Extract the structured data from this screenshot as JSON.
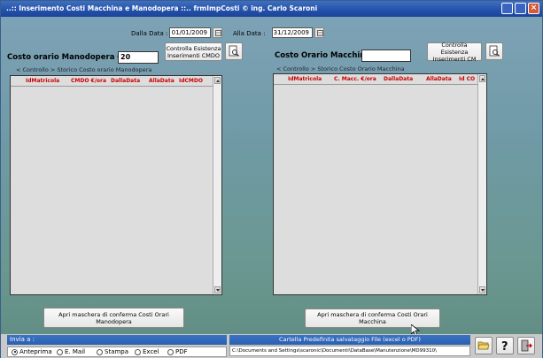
{
  "window": {
    "title": "..:: Inserimento Costi Macchina e Manodopera ::..  frmImpCosti © ing. Carlo Scaroni"
  },
  "filters": {
    "dalla_data_label": "Dalla Data :",
    "dalla_data_value": "01/01/2009",
    "alla_data_label": "Alla Data :",
    "alla_data_value": "31/12/2009"
  },
  "manodopera": {
    "label": "Costo orario Manodopera € :",
    "value": "20",
    "check_button": "Controlla Esistenza Inserimenti CMDO",
    "history_label": "< Controllo > Storico Costo orario Manodopera",
    "columns": [
      "IdMatricola",
      "CMDO €/ora",
      "DallaData",
      "AllaData",
      "IdCMDO"
    ],
    "open_button": "Apri maschera di conferma Costi Orari Manodopera"
  },
  "macchina": {
    "label": "Costo Orario Macchina € :",
    "value": "",
    "check_button": "Controlla Esistenza Inserimenti CM",
    "history_label": "< Controllo > Storico Costo Orario Macchina",
    "columns": [
      "IdMatricola",
      "C. Macc. €/ora",
      "DallaData",
      "AllaData",
      "Id CO"
    ],
    "open_button": "Apri maschera di conferma Costi Orari Macchina"
  },
  "invia": {
    "header": "Invia a :",
    "options": [
      "Anteprima",
      "E. Mail",
      "Stampa",
      "Excel",
      "PDF"
    ],
    "selected": "Anteprima"
  },
  "cartella": {
    "header": "Cartella Predefinita salvataggio File (excel o PDF)",
    "path": "C:\\Documents and Settings\\scaronic\\Documenti\\DataBase\\Manutenzione\\MD99310\\"
  },
  "icons": {
    "preview": "magnifier-document-icon",
    "folder": "folder-open-icon",
    "help": "help-icon",
    "exit": "exit-door-icon"
  }
}
